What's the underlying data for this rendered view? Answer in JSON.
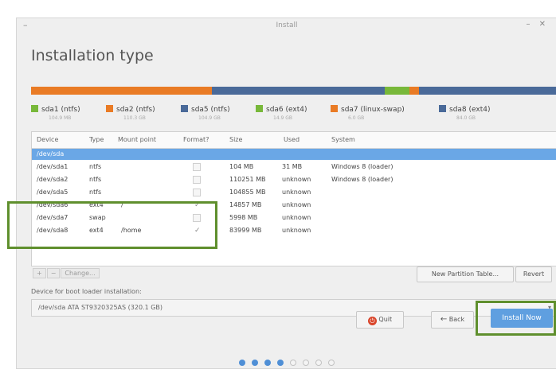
{
  "window": {
    "title": "Install",
    "menu_glyph": "–",
    "window_buttons": "– ✕"
  },
  "page_title": "Installation type",
  "partition_bar": [
    {
      "name": "sda1 (ntfs)",
      "size": "104.9 MB",
      "color": "#78b83a",
      "fraction": 0.0
    },
    {
      "name": "sda2 (ntfs)",
      "size": "110.3 GB",
      "color": "#e97b25",
      "fraction": 0.345
    },
    {
      "name": "sda5 (ntfs)",
      "size": "104.9 GB",
      "color": "#4a6a99",
      "fraction": 0.328
    },
    {
      "name": "sda6 (ext4)",
      "size": "14.9 GB",
      "color": "#78b83a",
      "fraction": 0.047
    },
    {
      "name": "sda7 (linux-swap)",
      "size": "6.0 GB",
      "color": "#e97b25",
      "fraction": 0.019
    },
    {
      "name": "sda8 (ext4)",
      "size": "84.0 GB",
      "color": "#4a6a99",
      "fraction": 0.262
    }
  ],
  "table": {
    "columns": [
      "Device",
      "Type",
      "Mount point",
      "Format?",
      "Size",
      "Used",
      "System"
    ],
    "rows": [
      {
        "device": "/dev/sda",
        "type": "",
        "mount": "",
        "format": "none",
        "size": "",
        "used": "",
        "system": "",
        "selected": true
      },
      {
        "device": "/dev/sda1",
        "type": "ntfs",
        "mount": "",
        "format": "box",
        "size": "104 MB",
        "used": "31 MB",
        "system": "Windows 8 (loader)",
        "selected": false
      },
      {
        "device": "/dev/sda2",
        "type": "ntfs",
        "mount": "",
        "format": "box",
        "size": "110251 MB",
        "used": "unknown",
        "system": "Windows 8 (loader)",
        "selected": false
      },
      {
        "device": "/dev/sda5",
        "type": "ntfs",
        "mount": "",
        "format": "box",
        "size": "104855 MB",
        "used": "unknown",
        "system": "",
        "selected": false
      },
      {
        "device": "/dev/sda6",
        "type": "ext4",
        "mount": "/",
        "format": "check",
        "size": "14857 MB",
        "used": "unknown",
        "system": "",
        "selected": false
      },
      {
        "device": "/dev/sda7",
        "type": "swap",
        "mount": "",
        "format": "box",
        "size": "5998 MB",
        "used": "unknown",
        "system": "",
        "selected": false
      },
      {
        "device": "/dev/sda8",
        "type": "ext4",
        "mount": "/home",
        "format": "check",
        "size": "83999 MB",
        "used": "unknown",
        "system": "",
        "selected": false
      }
    ]
  },
  "partition_buttons": {
    "add": "+",
    "remove": "−",
    "change": "Change..."
  },
  "new_partition_table_label": "New Partition Table...",
  "revert_label": "Revert",
  "boot_loader": {
    "label": "Device for boot loader installation:",
    "value": "/dev/sda   ATA ST9320325AS (320.1 GB)"
  },
  "buttons": {
    "quit": "Quit",
    "back": "Back",
    "install": "Install Now"
  },
  "progress": {
    "total": 8,
    "current": 4
  }
}
